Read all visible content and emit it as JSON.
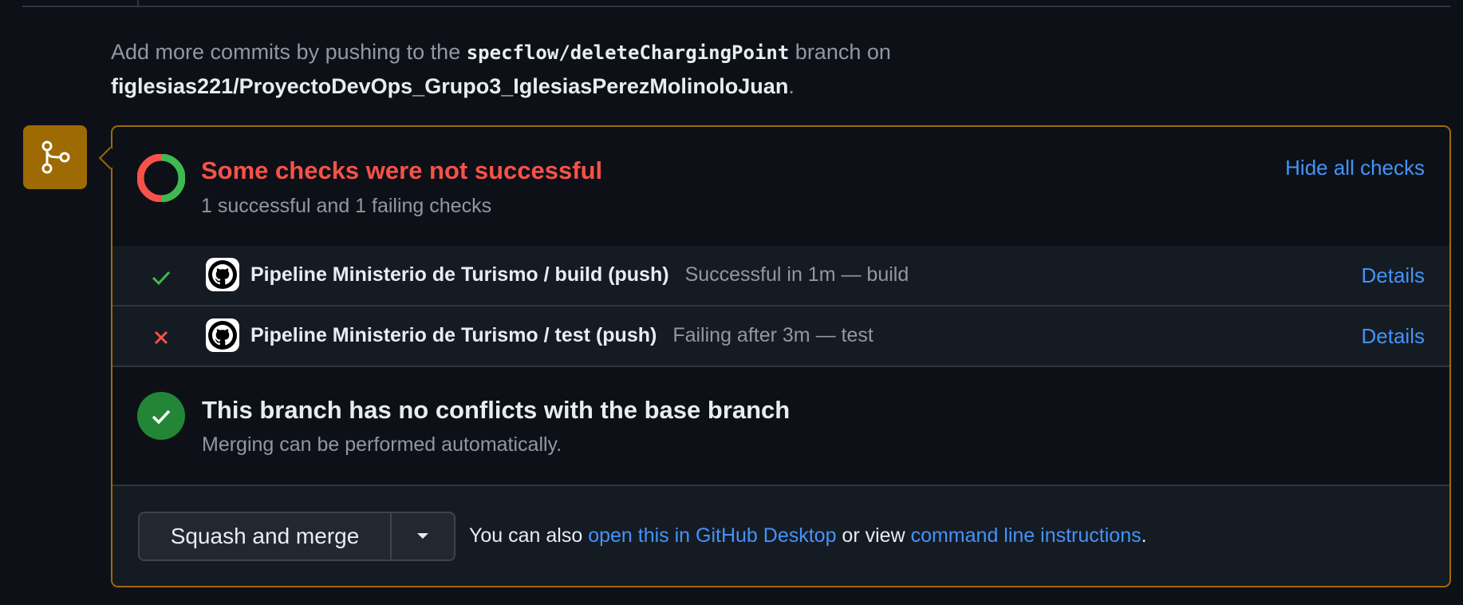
{
  "hint": {
    "prefix": "Add more commits by pushing to the ",
    "branch": "specflow/deleteChargingPoint",
    "middle": " branch on",
    "repo": "figlesias221/ProyectoDevOps_Grupo3_IglesiasPerezMolinoloJuan",
    "suffix": "."
  },
  "checks": {
    "title": "Some checks were not successful",
    "subtitle": "1 successful and 1 failing checks",
    "hide_label": "Hide all checks",
    "rows": [
      {
        "status": "success",
        "icon": "check-icon",
        "color": "#3fb950",
        "name": "Pipeline Ministerio de Turismo / build (push)",
        "desc": "Successful in 1m — build",
        "details": "Details"
      },
      {
        "status": "failure",
        "icon": "x-icon",
        "color": "#f85149",
        "name": "Pipeline Ministerio de Turismo / test (push)",
        "desc": "Failing after 3m — test",
        "details": "Details"
      }
    ]
  },
  "conflicts": {
    "title": "This branch has no conflicts with the base branch",
    "subtitle": "Merging can be performed automatically."
  },
  "merge": {
    "button_label": "Squash and merge",
    "text_prefix": "You can also ",
    "desktop_link": "open this in GitHub Desktop",
    "text_middle": " or view ",
    "cli_link": "command line instructions",
    "text_suffix": "."
  },
  "colors": {
    "accent": "#4493f8",
    "warning_border": "#9e6a03",
    "success": "#3fb950",
    "danger": "#f85149",
    "merge_ok": "#238636"
  }
}
